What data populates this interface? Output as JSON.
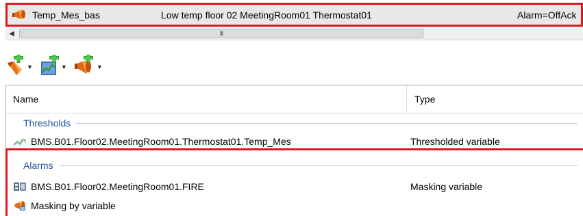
{
  "alarm": {
    "name": "Temp_Mes_bas",
    "description": "Low temp floor 02 MeetingRoom01 Thermostat01",
    "status": "Alarm=OffAck"
  },
  "scrollbar": {
    "thumb_grip": "III"
  },
  "toolbar": {
    "buttons": [
      {
        "icon": "add-threshold-icon"
      },
      {
        "icon": "add-variable-icon"
      },
      {
        "icon": "add-alarm-icon"
      }
    ]
  },
  "grid": {
    "columns": {
      "name": "Name",
      "type": "Type"
    },
    "groups": [
      {
        "label": "Thresholds",
        "rows": [
          {
            "icon": "trend-icon",
            "name": "BMS.B01.Floor02.MeetingRoom01.Thermostat01.Temp_Mes",
            "type": "Thresholded variable"
          }
        ]
      },
      {
        "label": "Alarms",
        "rows": [
          {
            "icon": "masking-variable-icon",
            "name": "BMS.B01.Floor02.MeetingRoom01.FIRE",
            "type": "Masking variable"
          },
          {
            "icon": "alarm-horn-icon",
            "name": "Masking by variable",
            "type": ""
          }
        ]
      }
    ]
  },
  "colors": {
    "highlight_border": "#e0141e",
    "group_text": "#1f4e9d",
    "row_background": "#e8e8e8"
  }
}
